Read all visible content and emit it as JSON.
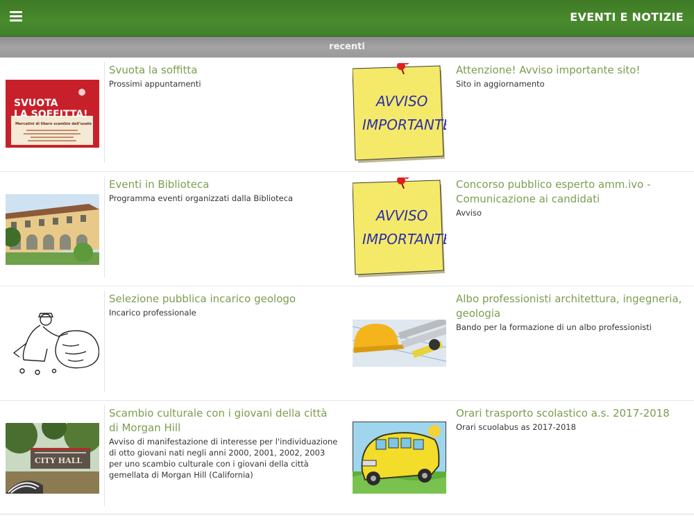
{
  "header": {
    "title": "EVENTI E NOTIZIE",
    "menu_icon": "hamburger-menu-icon"
  },
  "section": {
    "label": "recenti"
  },
  "items": [
    {
      "title": "Svuota la soffitta",
      "desc": "Prossimi appuntamenti",
      "thumb": {
        "line1": "SVUOTA",
        "line2": "LA SOFFITTA!",
        "line3": "Mercatini di libero scambio dell'usato"
      }
    },
    {
      "title": "Attenzione! Avviso importante sito!",
      "desc": "Sito in aggiornamento",
      "thumb": {
        "line1": "AVVISO",
        "line2": "IMPORTANTE"
      }
    },
    {
      "title": "Eventi in Biblioteca",
      "desc": "Programma eventi organizzati dalla Biblioteca"
    },
    {
      "title": "Concorso pubblico esperto amm.ivo - Comunicazione ai candidati",
      "desc": "Avviso",
      "thumb": {
        "line1": "AVVISO",
        "line2": "IMPORTANTE"
      }
    },
    {
      "title": "Selezione pubblica incarico geologo",
      "desc": "Incarico professionale"
    },
    {
      "title": "Albo professionisti architettura, ingegneria, geologia",
      "desc": "Bando per la formazione di un albo professionisti"
    },
    {
      "title": "Scambio culturale con i giovani della città di Morgan Hill",
      "desc": "Avviso di manifestazione di interesse per l'individuazione di otto giovani nati negli anni 2000, 2001, 2002, 2003 per uno scambio culturale con i giovani della città gemellata di Morgan Hill (California)",
      "thumb": {
        "line1": "CITY HALL"
      }
    },
    {
      "title": "Orari trasporto scolastico a.s. 2017-2018",
      "desc": "Orari scuolabus as 2017-2018"
    }
  ]
}
